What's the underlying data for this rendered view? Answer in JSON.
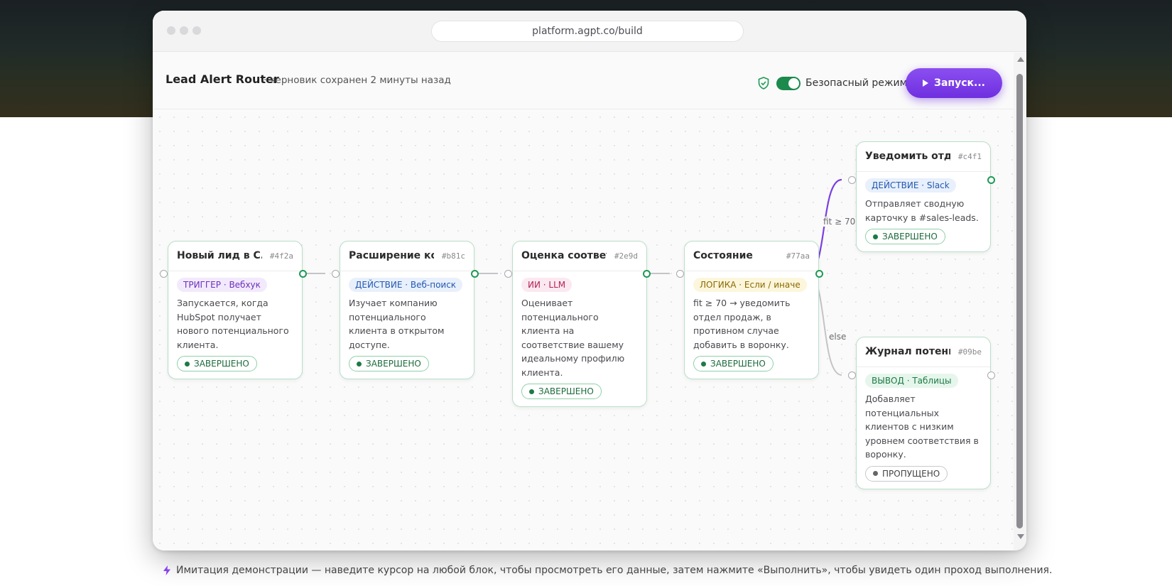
{
  "browser": {
    "url": "platform.agpt.co/build"
  },
  "toolbar": {
    "title": "Lead Alert Router",
    "subtitle": "· черновик сохранен 2 минуты назад",
    "safe_mode_label": "Безопасный режим",
    "safe_mode_on": true,
    "run_label": "Запуск..."
  },
  "nodes": [
    {
      "title": "Новый лид в C...",
      "id": "#4f2a",
      "tag": "ТРИГГЕР · Вебхук",
      "desc": "Запускается, когда HubSpot получает нового потенциального клиента.",
      "status": "ЗАВЕРШЕНО"
    },
    {
      "title": "Расширение ко...",
      "id": "#b81c",
      "tag": "ДЕЙСТВИЕ · Веб-поиск",
      "desc": "Изучает компанию потенциального клиента в открытом доступе.",
      "status": "ЗАВЕРШЕНО"
    },
    {
      "title": "Оценка соответ...",
      "id": "#2e9d",
      "tag": "ИИ · LLM",
      "desc": "Оценивает потенциального клиента на соответствие вашему идеальному профилю клиента.",
      "status": "ЗАВЕРШЕНО"
    },
    {
      "title": "Состояние",
      "id": "#77aa",
      "tag": "ЛОГИКА · Если / иначе",
      "desc": "fit ≥ 70 → уведомить отдел продаж, в противном случае добавить в воронку.",
      "status": "ЗАВЕРШЕНО"
    },
    {
      "title": "Уведомить отде...",
      "id": "#c4f1",
      "tag": "ДЕЙСТВИЕ · Slack",
      "desc": "Отправляет сводную карточку в #sales-leads.",
      "status": "ЗАВЕРШЕНО"
    },
    {
      "title": "Журнал потенц...",
      "id": "#09be",
      "tag": "ВЫВОД · Таблицы",
      "desc": "Добавляет потенциальных клиентов с низким уровнем соответствия в воронку.",
      "status": "ПРОПУЩЕНО"
    }
  ],
  "edges": {
    "fit_label": "fit ≥ 70",
    "else_label": "else"
  },
  "colors": {
    "accent": "#7b3fe4",
    "success": "#1d9a55",
    "edge": "#c4c4c8"
  },
  "footer": {
    "icon": "bolt-icon",
    "text": "Имитация демонстрации — наведите курсор на любой блок, чтобы просмотреть его данные, затем нажмите «Выполнить», чтобы увидеть один проход выполнения."
  }
}
